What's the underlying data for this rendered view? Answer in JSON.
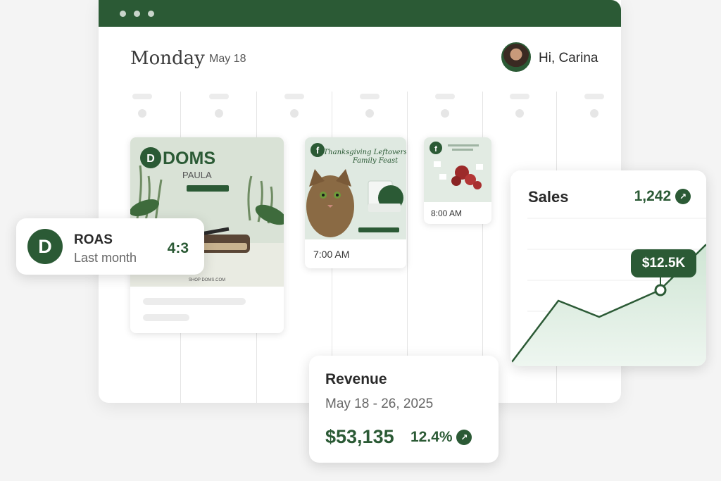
{
  "header": {
    "day": "Monday",
    "date": "May 18",
    "greeting": "Hi, Carina"
  },
  "cards": {
    "doms": {
      "brand": "DOMS",
      "subtitle": "PAULA",
      "footer_text": "SHOP DOMS.COM"
    },
    "thanksgiving": {
      "title_line1": "Thanksgiving Leftovers",
      "title_line2": "Family Feast",
      "time": "7:00 AM"
    },
    "food": {
      "time": "8:00 AM"
    }
  },
  "roas": {
    "title": "ROAS",
    "subtitle": "Last month",
    "value": "4:3"
  },
  "sales": {
    "title": "Sales",
    "count": "1,242",
    "tooltip": "$12.5K"
  },
  "revenue": {
    "title": "Revenue",
    "range": "May 18 - 26, 2025",
    "amount": "$53,135",
    "change": "12.4%"
  },
  "colors": {
    "brand_green": "#2b5a35",
    "light_green": "#dcecdf"
  },
  "icons": {
    "facebook": "facebook-icon",
    "trend_up": "arrow-up-right-icon",
    "brand_logo": "doms-logo-icon"
  }
}
